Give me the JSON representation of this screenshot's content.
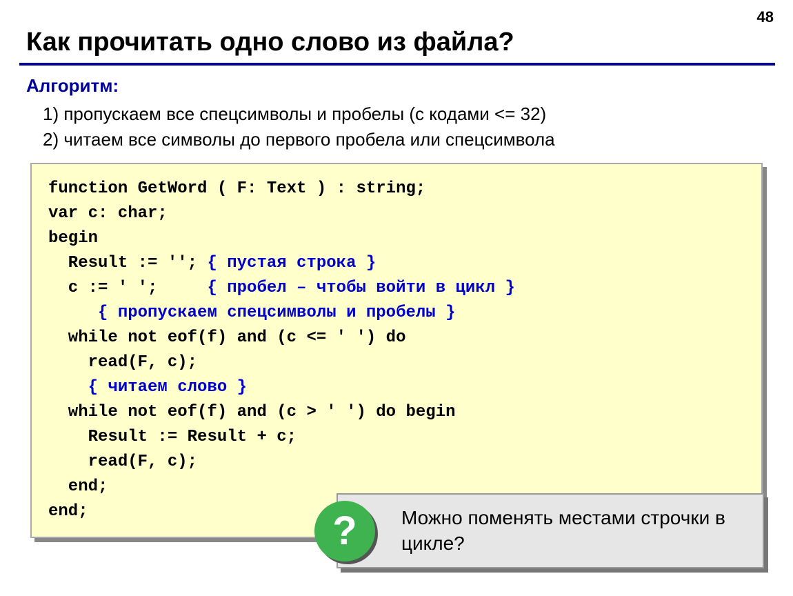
{
  "page_number": "48",
  "title": "Как прочитать одно слово из файла?",
  "subheading": "Алгоритм:",
  "steps": [
    "1) пропускаем все спецсимволы и пробелы (с кодами <= 32)",
    "2) читаем все символы до первого пробела или спецсимвола"
  ],
  "code": {
    "l1": "function GetWord ( F: Text ) : string;",
    "l2": "var c: char;",
    "l3": "begin",
    "l4a": "  Result := ''; ",
    "l4b": "{ пустая строка }",
    "l5a": "  c := ' ';     ",
    "l5b": "{ пробел – чтобы войти в цикл }",
    "l6": "     { пропускаем спецсимволы и пробелы }",
    "l7": "  while not eof(f) and (c <= ' ') do",
    "l8": "    read(F, c);",
    "l9": "    { читаем слово }",
    "l10": "  while not eof(f) and (c > ' ') do begin",
    "l11": "    Result := Result + c;",
    "l12": "    read(F, c);",
    "l13": "  end;",
    "l14": "end;"
  },
  "callout": {
    "icon": "?",
    "text": "Можно поменять местами строчки в цикле?"
  }
}
